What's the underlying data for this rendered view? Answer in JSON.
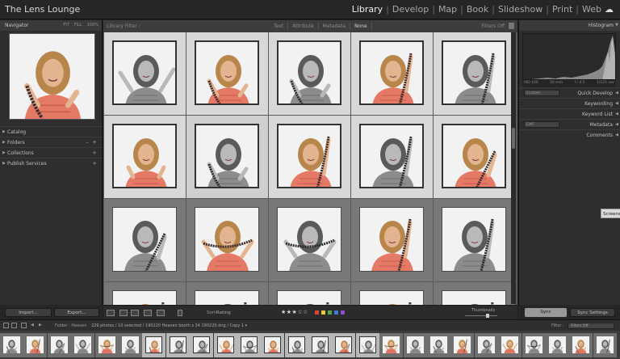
{
  "app": {
    "title": "The Lens Lounge"
  },
  "modules": [
    "Library",
    "Develop",
    "Map",
    "Book",
    "Slideshow",
    "Print",
    "Web"
  ],
  "active_module": "Library",
  "left_panel": {
    "navigator": {
      "title": "Navigator",
      "options": [
        "FIT",
        "FILL",
        "100%"
      ]
    },
    "sections": [
      {
        "label": "Catalog",
        "has_add": false
      },
      {
        "label": "Folders",
        "has_add": true
      },
      {
        "label": "Collections",
        "has_add": true
      },
      {
        "label": "Publish Services",
        "has_add": true
      }
    ],
    "import_label": "Import...",
    "export_label": "Export..."
  },
  "filter_bar": {
    "label": "Library Filter :",
    "tabs": [
      "Text",
      "Attribute",
      "Metadata",
      "None"
    ],
    "selected_tab": "None",
    "filters_off": "Filters Off"
  },
  "grid": {
    "cells": [
      {
        "tone": "bw",
        "pose": "arms-up"
      },
      {
        "tone": "color",
        "pose": "film-hold"
      },
      {
        "tone": "bw",
        "pose": "film-hold"
      },
      {
        "tone": "color",
        "pose": "film-up"
      },
      {
        "tone": "bw",
        "pose": "film-up"
      },
      {
        "tone": "color",
        "pose": "hands"
      },
      {
        "tone": "bw",
        "pose": "film-hold",
        "selected": true
      },
      {
        "tone": "color",
        "pose": "film-up"
      },
      {
        "tone": "bw",
        "pose": "film-up"
      },
      {
        "tone": "color",
        "pose": "laugh"
      },
      {
        "tone": "bw",
        "pose": "laugh"
      },
      {
        "tone": "color",
        "pose": "film-wide"
      },
      {
        "tone": "bw",
        "pose": "film-wide"
      },
      {
        "tone": "color",
        "pose": "film-up"
      },
      {
        "tone": "bw",
        "pose": "film-up"
      },
      {
        "tone": "color",
        "pose": "film-up"
      },
      {
        "tone": "bw",
        "pose": "film-up"
      },
      {
        "tone": "bw",
        "pose": "film-up"
      },
      {
        "tone": "color",
        "pose": "film-up"
      },
      {
        "tone": "bw",
        "pose": "film-up"
      }
    ]
  },
  "right_panel": {
    "histogram": {
      "title": "Histogram",
      "info": [
        "ISO 100",
        "50 mm",
        "f / 4.5",
        "1/125 sec"
      ]
    },
    "sections": [
      {
        "label": "Quick Develop",
        "preset": "Custom"
      },
      {
        "label": "Keywording"
      },
      {
        "label": "Keyword List"
      },
      {
        "label": "Metadata",
        "preset": "EXIF"
      },
      {
        "label": "Comments"
      }
    ],
    "sync_label": "Sync",
    "sync_settings_label": "Sync Settings"
  },
  "screen_tag": "Screens",
  "toolbar": {
    "sort_label": "Sort:",
    "sort_value": "Rating",
    "stars": "★★★☆☆",
    "label_colors": [
      "#d9463b",
      "#e7c93a",
      "#52a64b",
      "#3f79d4",
      "#8a4fcf"
    ],
    "thumbnails_label": "Thumbnails",
    "thumbnail_size": 0.7
  },
  "filmstrip_header": {
    "path": "Folder : Heaven",
    "info": "229 photos / 10 selected / 190220 Heaven booth s 34 190220.dng / Copy 1 ▾",
    "filter_label": "Filter :",
    "filter_value": "Filters Off"
  },
  "filmstrip": {
    "items": [
      "bw",
      "color",
      "bw",
      "bw",
      "color",
      "bw",
      "color",
      "bw",
      "bw",
      "color",
      "bw",
      "color",
      "bw",
      "bw",
      "color",
      "bw",
      "color",
      "bw",
      "bw",
      "color",
      "bw",
      "color",
      "bw",
      "bw",
      "color",
      "bw"
    ],
    "highlighted": [
      6,
      7,
      8,
      9,
      10,
      11,
      12,
      13,
      14,
      15
    ]
  },
  "colors": {
    "skin": "#e2b48f",
    "hair_color": "#b8864a",
    "top_color": "#e47965",
    "film": "#3a2a2a"
  }
}
